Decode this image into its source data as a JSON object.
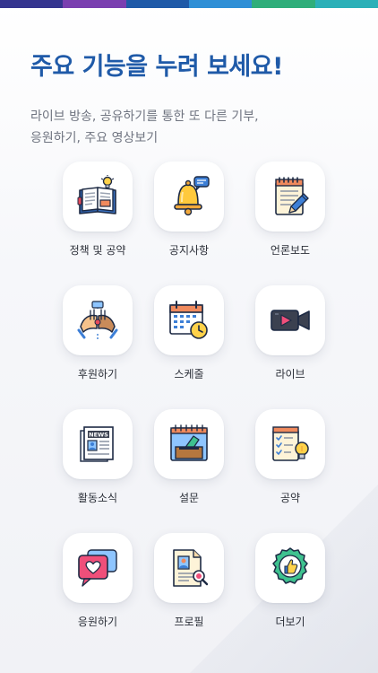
{
  "header": {
    "title": "주요 기능을 누려 보세요!",
    "subtitle_line1": "라이브 방송, 공유하기를 통한 또 다른 기부,",
    "subtitle_line2": "응원하기, 주요 영상보기"
  },
  "colors": {
    "title": "#1f5aa8",
    "subtitle": "#6f7480",
    "top_bar": [
      "#35358f",
      "#7a3fb0",
      "#1f5aa8",
      "#2f8fd6",
      "#2fae7a",
      "#2bb0b8"
    ]
  },
  "features": [
    {
      "label": "정책 및 공약",
      "icon": "book-lightbulb-icon"
    },
    {
      "label": "공지사항",
      "icon": "bell-icon"
    },
    {
      "label": "언론보도",
      "icon": "notepad-pencil-icon"
    },
    {
      "label": "후원하기",
      "icon": "helping-hands-icon"
    },
    {
      "label": "스케줄",
      "icon": "calendar-clock-icon"
    },
    {
      "label": "라이브",
      "icon": "video-camera-icon"
    },
    {
      "label": "활동소식",
      "icon": "newspaper-icon"
    },
    {
      "label": "설문",
      "icon": "ballot-box-icon"
    },
    {
      "label": "공약",
      "icon": "checklist-lightbulb-icon"
    },
    {
      "label": "응원하기",
      "icon": "heart-chat-icon"
    },
    {
      "label": "프로필",
      "icon": "profile-document-icon"
    },
    {
      "label": "더보기",
      "icon": "thumbs-up-badge-icon"
    }
  ]
}
